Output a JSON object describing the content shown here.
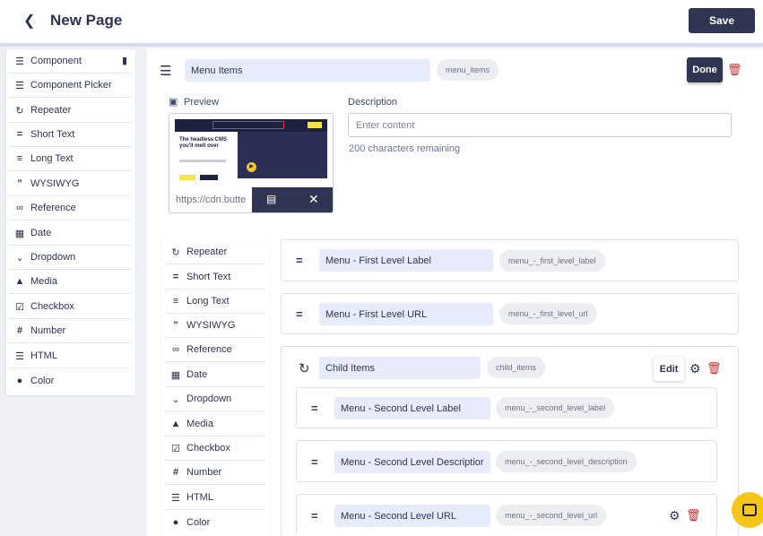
{
  "header": {
    "title": "New Page",
    "save_label": "Save"
  },
  "left_sidebar": [
    {
      "label": "Component",
      "icon": "layers-icon",
      "glyph": "≡"
    },
    {
      "label": "Component Picker",
      "icon": "component-picker-icon",
      "glyph": "≡"
    },
    {
      "label": "Repeater",
      "icon": "repeat-icon",
      "glyph": "↻"
    },
    {
      "label": "Short Text",
      "icon": "short-text-icon",
      "glyph": "="
    },
    {
      "label": "Long Text",
      "icon": "long-text-icon",
      "glyph": "≡"
    },
    {
      "label": "WYSIWYG",
      "icon": "quote-icon",
      "glyph": "”"
    },
    {
      "label": "Reference",
      "icon": "link-icon",
      "glyph": "∞"
    },
    {
      "label": "Date",
      "icon": "calendar-icon",
      "glyph": "▦"
    },
    {
      "label": "Dropdown",
      "icon": "chevron-down-icon",
      "glyph": "⌄"
    },
    {
      "label": "Media",
      "icon": "media-icon",
      "glyph": "▲"
    },
    {
      "label": "Checkbox",
      "icon": "checkbox-icon",
      "glyph": "☑"
    },
    {
      "label": "Number",
      "icon": "hash-icon",
      "glyph": "#"
    },
    {
      "label": "HTML",
      "icon": "list-icon",
      "glyph": "☰"
    },
    {
      "label": "Color",
      "icon": "palette-icon",
      "glyph": "●"
    }
  ],
  "component": {
    "name": "Menu Items",
    "key": "menu_items",
    "done_label": "Done",
    "preview_label": "Preview",
    "preview_url": "https://cdn.butte",
    "preview_headline": "The headless CMS you'll melt over",
    "description_label": "Description",
    "description_placeholder": "Enter content",
    "remaining": "200 characters remaining"
  },
  "mid_sidebar": [
    {
      "label": "Repeater",
      "icon": "repeat-icon",
      "glyph": "↻"
    },
    {
      "label": "Short Text",
      "icon": "short-text-icon",
      "glyph": "="
    },
    {
      "label": "Long Text",
      "icon": "long-text-icon",
      "glyph": "≡"
    },
    {
      "label": "WYSIWYG",
      "icon": "quote-icon",
      "glyph": "”"
    },
    {
      "label": "Reference",
      "icon": "link-icon",
      "glyph": "∞"
    },
    {
      "label": "Date",
      "icon": "calendar-icon",
      "glyph": "▦"
    },
    {
      "label": "Dropdown",
      "icon": "chevron-down-icon",
      "glyph": "⌄"
    },
    {
      "label": "Media",
      "icon": "media-icon",
      "glyph": "▲"
    },
    {
      "label": "Checkbox",
      "icon": "checkbox-icon",
      "glyph": "☑"
    },
    {
      "label": "Number",
      "icon": "hash-icon",
      "glyph": "#"
    },
    {
      "label": "HTML",
      "icon": "list-icon",
      "glyph": "☰"
    },
    {
      "label": "Color",
      "icon": "palette-icon",
      "glyph": "●"
    }
  ],
  "fields": [
    {
      "name": "Menu - First Level Label",
      "key": "menu_-_first_level_label"
    },
    {
      "name": "Menu - First Level URL",
      "key": "menu_-_first_level_url"
    }
  ],
  "repeater": {
    "name": "Child Items",
    "key": "child_items",
    "edit_label": "Edit",
    "fields": [
      {
        "name": "Menu - Second Level Label",
        "key": "menu_-_second_level_label"
      },
      {
        "name": "Menu - Second Level Descriptior",
        "key": "menu_-_second_level_description"
      },
      {
        "name": "Menu - Second Level URL",
        "key": "menu_-_second_level_url"
      }
    ]
  },
  "colors": {
    "primary": "#2f3552",
    "accent": "#e8ebf9",
    "danger": "#c62f2f",
    "chat": "#f5c518"
  }
}
